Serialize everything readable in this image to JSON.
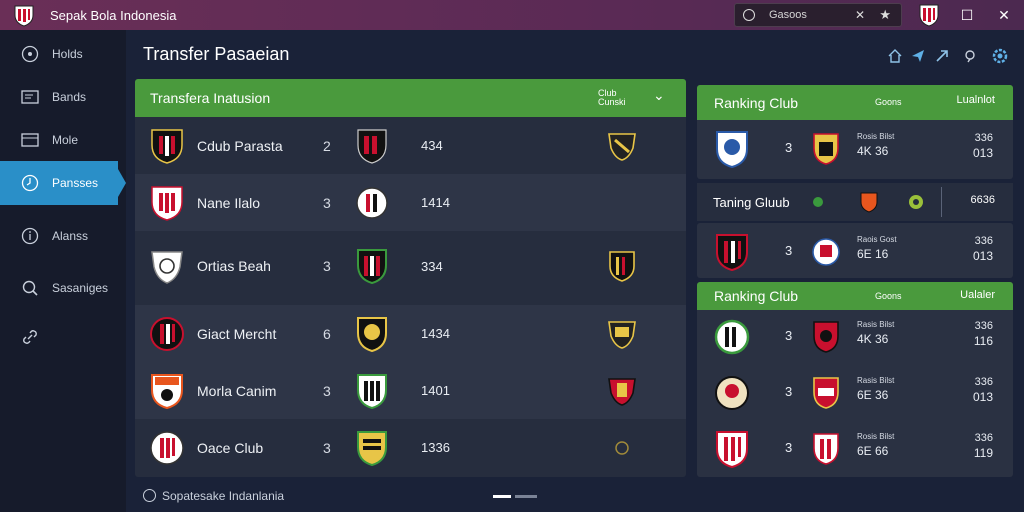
{
  "app": {
    "title": "Sepak Bola Indonesia"
  },
  "search": {
    "value": "Gasoos"
  },
  "sidebar": {
    "items": [
      {
        "label": "Holds",
        "icon": "target-icon"
      },
      {
        "label": "Bands",
        "icon": "card-icon"
      },
      {
        "label": "Mole",
        "icon": "box-icon"
      },
      {
        "label": "Pansses",
        "icon": "clock-icon",
        "active": true
      },
      {
        "label": "Alanss",
        "icon": "info-icon"
      },
      {
        "label": "Sasaniges",
        "icon": "search-icon"
      },
      {
        "label": "",
        "icon": "link-icon"
      }
    ]
  },
  "main": {
    "title": "Transfer Pasaeian"
  },
  "transfer": {
    "header": "Transfera Inatusion",
    "header_small": "Club Cunski",
    "rows": [
      {
        "name": "Cdub Parasta",
        "num": "2",
        "value": "434"
      },
      {
        "name": "Nane Ilalo",
        "num": "3",
        "value": "1414"
      },
      {
        "name": "Ortias Beah",
        "num": "3",
        "value": "334"
      },
      {
        "name": "Giact Mercht",
        "num": "6",
        "value": "1434"
      },
      {
        "name": "Morla Canim",
        "num": "3",
        "value": "1401"
      },
      {
        "name": "Oace Club",
        "num": "3",
        "value": "1336"
      }
    ]
  },
  "footer": {
    "text": "Sopatesake Indanlania"
  },
  "ranking1": {
    "title": "Ranking Club",
    "sub": "Goons",
    "right": "Lualnlot",
    "rows": [
      {
        "num": "3",
        "s1": "Rosis Bilst",
        "s2": "4K 36",
        "v1": "336",
        "v2": "013"
      }
    ]
  },
  "midbar": {
    "title": "Taning Gluub",
    "right": "6636"
  },
  "ranking_mid": {
    "rows": [
      {
        "num": "3",
        "s1": "Raois Gost",
        "s2": "6E 16",
        "v1": "336",
        "v2": "013"
      }
    ]
  },
  "ranking2": {
    "title": "Ranking Club",
    "sub": "Goons",
    "right": "Ualaler",
    "rows": [
      {
        "num": "3",
        "s1": "Rasis Bilst",
        "s2": "4K 36",
        "v1": "336",
        "v2": "116"
      },
      {
        "num": "3",
        "s1": "Rasis Bilst",
        "s2": "6E 36",
        "v1": "336",
        "v2": "013"
      },
      {
        "num": "3",
        "s1": "Rosis Bilst",
        "s2": "6E 66",
        "v1": "336",
        "v2": "119"
      }
    ]
  },
  "colors": {
    "accent": "#4a9a3d",
    "active_nav": "#2a8fc8",
    "background": "#1a2238",
    "titlebar": "#6a2f57"
  }
}
